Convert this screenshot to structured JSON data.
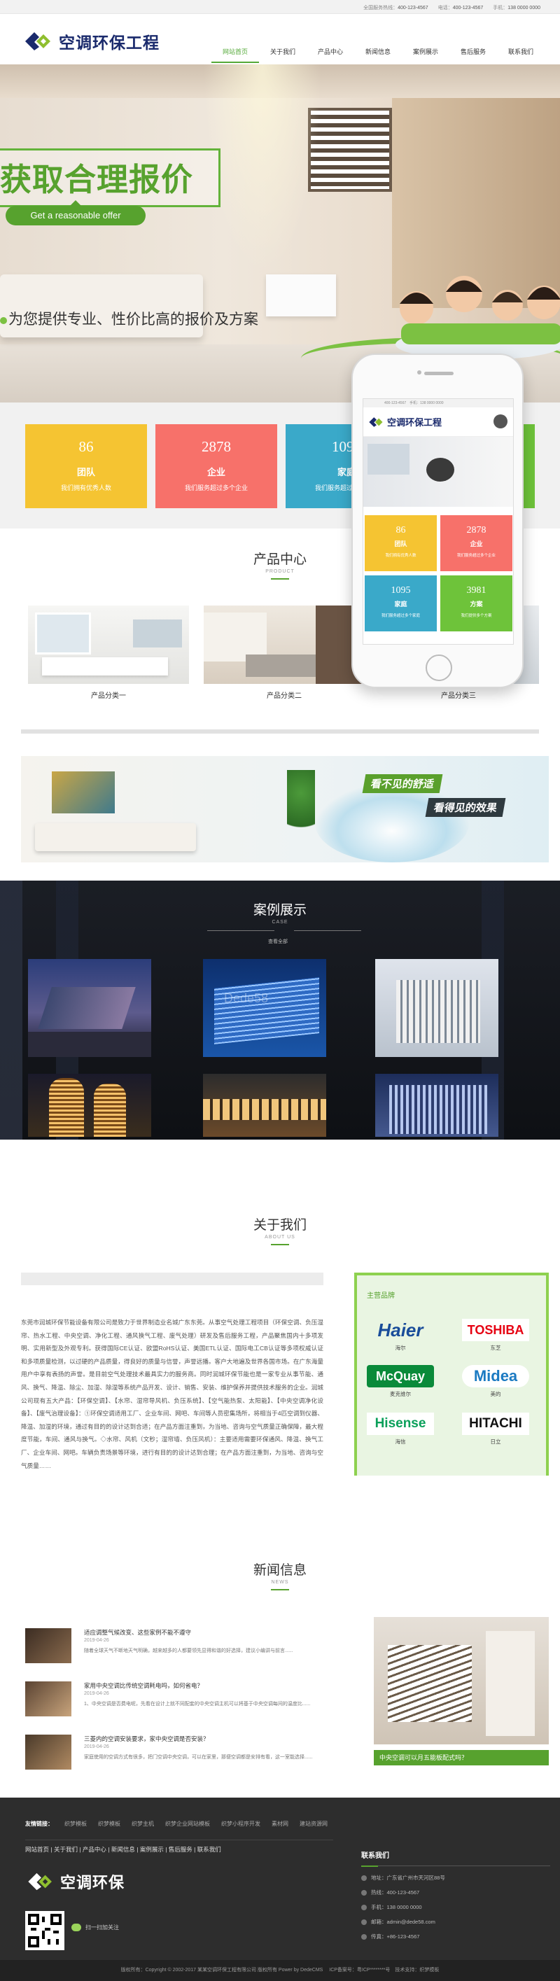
{
  "topbar": {
    "items": [
      {
        "label": "全国服务热线：",
        "value": "400-123-4567"
      },
      {
        "label": "电话：",
        "value": "400-123-4567"
      },
      {
        "label": "手机：",
        "value": "138 0000 0000"
      }
    ]
  },
  "brand": {
    "name": "空调环保工程",
    "footer_name": "空调环保"
  },
  "nav": [
    "网站首页",
    "关于我们",
    "产品中心",
    "新闻信息",
    "案例展示",
    "售后服务",
    "联系我们"
  ],
  "banner": {
    "title": "获取合理报价",
    "button": "Get a reasonable offer",
    "subtitle": "为您提供专业、性价比高的报价及方案"
  },
  "stats": [
    {
      "num": "86",
      "label": "团队",
      "desc": "我们拥有优秀人数",
      "color": "#f5c432"
    },
    {
      "num": "2878",
      "label": "企业",
      "desc": "我们服务超过多个企业",
      "color": "#f7716a"
    },
    {
      "num": "1095",
      "label": "家庭",
      "desc": "我们服务超过多个家庭",
      "color": "#3aa9c9"
    },
    {
      "num": "3981",
      "label": "方案",
      "desc": "我们提供多个方案",
      "color": "#6ec33a"
    }
  ],
  "products": {
    "title": "产品中心",
    "subtitle": "PRODUCT",
    "items": [
      "产品分类一",
      "产品分类二",
      "产品分类三"
    ]
  },
  "ad": {
    "line1": "看不见的舒适",
    "line2": "看得见的效果"
  },
  "cases": {
    "title": "案例展示",
    "subtitle": "CASE",
    "more": "查看全部",
    "watermark": "Dede58"
  },
  "about": {
    "title": "关于我们",
    "subtitle": "ABOUT US",
    "text": "东莞市润城环保节能设备有限公司是致力于世界制造业名城广东东莞。从事空气处理工程项目（环保空调、负压湿帘、热水工程、中央空调、净化工程、通风换气工程、废气处理）研发及售后服务工程，产品聚焦国内十多项发明、实用新型及外观专利。获得国际CE认证、欧盟RoHS认证、美国ETL认证、国际电工CB认证等多项权威认证和多项质量检测，以过硬的产品质量，得良好的质量与信誉，声誉远播。客户大地遍及世界各国市场。在广东海量用户中享有表扬的声誉。是目前空气处理技术最具实力的服务商。同时润城环保节能也是一家专业从事节能、通风、换气、降温、除尘、加湿、除湿等系统产品开发、设计、销售、安装、维护保养并提供技术服务的企业。润城公司现有五大产品：【环保空调】、【水帘、湿帘导风机、负压系统】、【空气能热泵、太阳能】、【中央空调净化设备】、【废气治理设备】：①环保空调适用工厂、企业车间、网吧、车间等人员密集场所，将相当于4匹空调到仪器、降温、加湿的环境，通过有目的的设计达到合适；在产品方面注重到，为当地、咨询与空气质量正确保障，最大程度节能，车间、通风与换气。◇水帘、风机（文秒；湿帘墙、负压风机）：主要适用需要环保通风、降温、换气工厂、企业车间、网吧。车辆负责场景等环境，进行有目的的设计达到合理；在产品方面注重到，为当地、咨询与空气质量……"
  },
  "brands_box": {
    "title": "主营品牌",
    "items": [
      {
        "logo": "Haier",
        "name": "海尔",
        "color": "#1a4d9a"
      },
      {
        "logo": "TOSHIBA",
        "name": "东芝",
        "color": "#e60012"
      },
      {
        "logo": "McQuay",
        "name": "麦克维尔",
        "color": "#0a8a3a"
      },
      {
        "logo": "Midea",
        "name": "美的",
        "color": "#1b7ac2"
      },
      {
        "logo": "Hisense",
        "name": "海信",
        "color": "#0aa05a"
      },
      {
        "logo": "HITACHI",
        "name": "日立",
        "color": "#111111"
      }
    ]
  },
  "news": {
    "title": "新闻信息",
    "subtitle": "NEWS",
    "items": [
      {
        "title": "适应调整气候改变、这些家例不能不遵守",
        "date": "2019-04-26",
        "excerpt": "随着全球天气不断地天气明确，越来越多的人都要领先显得和谐的好选择，建议小编讲与前言......"
      },
      {
        "title": "家用中央空调比传统空调耗电吗，如何省电？",
        "date": "2019-04-26",
        "excerpt": "1、中央空调是否费电呢，先看在设计上就不同配套的中央空调主机可以将基于中央空调每间的温度比......"
      },
      {
        "title": "三菱内的空调安装要求，家中央空调是否安装？",
        "date": "2019-04-26",
        "excerpt": "家庭使用的空调方式有很多，把门空调中央空调，可以在家里，那便空调都是安排有看，这一室能选择......"
      }
    ],
    "feature_caption": "中央空调可以月五能板配式吗？"
  },
  "footer": {
    "links_label": "友情链接：",
    "links": [
      "织梦模板",
      "织梦模板",
      "织梦主机",
      "织梦企业网站模板",
      "织梦小程序开发",
      "素材网",
      "建站资源网"
    ],
    "nav": [
      "网站首页",
      "关于我们",
      "产品中心",
      "新闻信息",
      "案例展示",
      "售后服务",
      "联系我们"
    ],
    "qr_label": "扫一扫加关注",
    "contact_title": "联系我们",
    "contact": [
      "地址：广东省广州市天河区88号",
      "热线：400-123-4567",
      "手机：138 0000 0000",
      "邮箱：admin@dede58.com",
      "传真：+86-123-4567"
    ],
    "copyright": "版权所有：Copyright © 2002-2017 某某空调环保工程有限公司 版权所有 Power by DedeCMS 　ICP备案号：粤ICP********号　技术支持：织梦模板"
  },
  "phone": {
    "topbar": "400-123-4567　手机：138 0000 0000",
    "brand": "空调环保工程"
  }
}
